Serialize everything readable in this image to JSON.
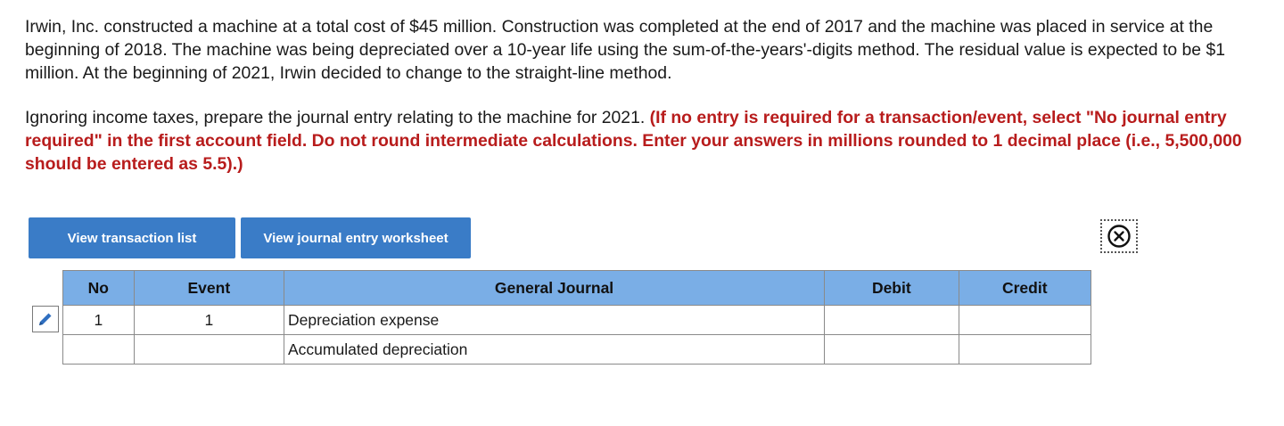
{
  "problem": {
    "paragraph1": "Irwin, Inc. constructed a machine at a total cost of $45 million. Construction was completed at the end of 2017 and the machine was placed in service at the beginning of 2018. The machine was being depreciated over a 10-year life using the sum-of-the-years'-digits method. The residual value is expected to be $1 million. At the beginning of 2021, Irwin decided to change to the straight-line method.",
    "instruction": "Ignoring income taxes, prepare the journal entry relating to the machine for 2021.",
    "instruction_note": "(If no entry is required for a transaction/event, select \"No journal entry required\" in the first account field. Do not round intermediate calculations. Enter your answers in millions rounded to 1 decimal place (i.e., 5,500,000 should be entered as 5.5).)"
  },
  "buttons": {
    "view_transaction_list": "View transaction list",
    "view_journal_entry_worksheet": "View journal entry worksheet"
  },
  "icons": {
    "close": "close-circle-x-icon",
    "edit": "pencil-icon"
  },
  "colors": {
    "button_bg": "#3a7cc7",
    "header_bg": "#7aaee6",
    "instruction_red": "#b81c1c"
  },
  "table": {
    "headers": {
      "no": "No",
      "event": "Event",
      "general_journal": "General Journal",
      "debit": "Debit",
      "credit": "Credit"
    },
    "rows": [
      {
        "no": "1",
        "event": "1",
        "account": "Depreciation expense",
        "debit": "",
        "credit": ""
      },
      {
        "no": "",
        "event": "",
        "account": "Accumulated depreciation",
        "debit": "",
        "credit": ""
      }
    ]
  }
}
